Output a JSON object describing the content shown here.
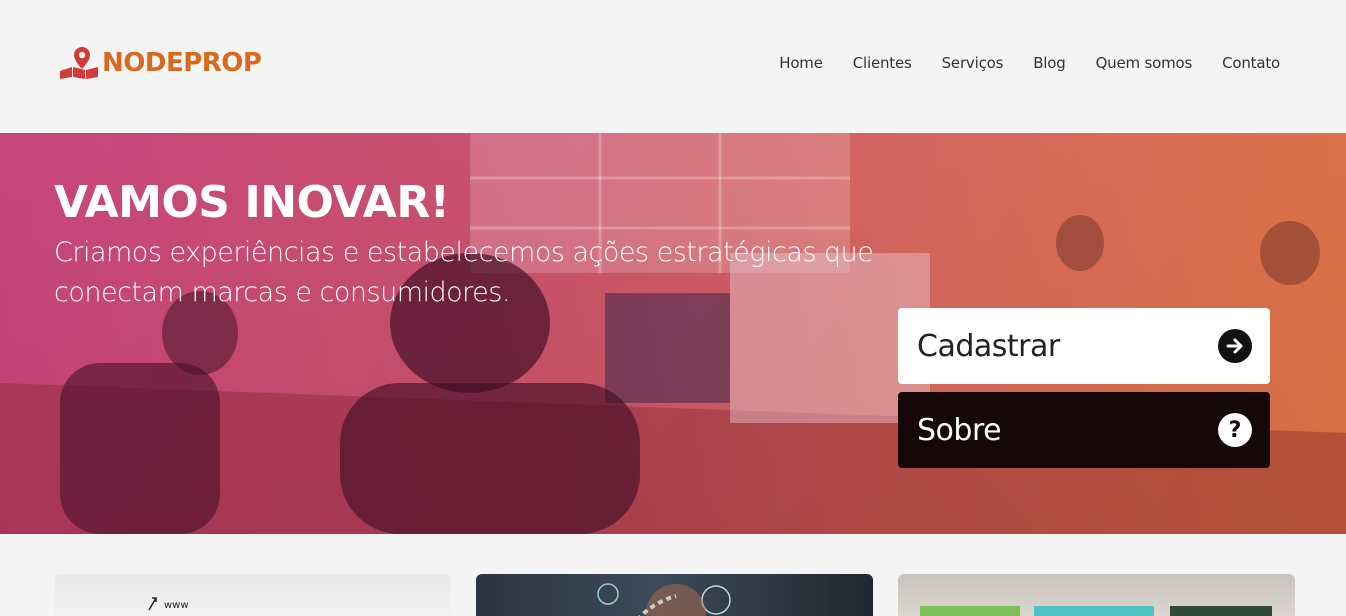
{
  "brand": {
    "name": "NODEPROP",
    "color": "#d9691d"
  },
  "nav": {
    "items": [
      {
        "label": "Home"
      },
      {
        "label": "Clientes"
      },
      {
        "label": "Serviços"
      },
      {
        "label": "Blog"
      },
      {
        "label": "Quem somos"
      },
      {
        "label": "Contato"
      }
    ]
  },
  "hero": {
    "title": "VAMOS INOVAR!",
    "subtitle": "Criamos experiências e estabelecemos ações estratégicas que conectam marcas e consumidores.",
    "overlay_colors": [
      "#c83c78",
      "#e16e3c"
    ]
  },
  "actions": {
    "register": {
      "label": "Cadastrar",
      "icon": "arrow-right-circle-icon"
    },
    "about": {
      "label": "Sobre",
      "icon": "question-circle-icon"
    }
  },
  "cards": [
    {
      "name": "card-web"
    },
    {
      "name": "card-mobile"
    },
    {
      "name": "card-apps"
    }
  ]
}
